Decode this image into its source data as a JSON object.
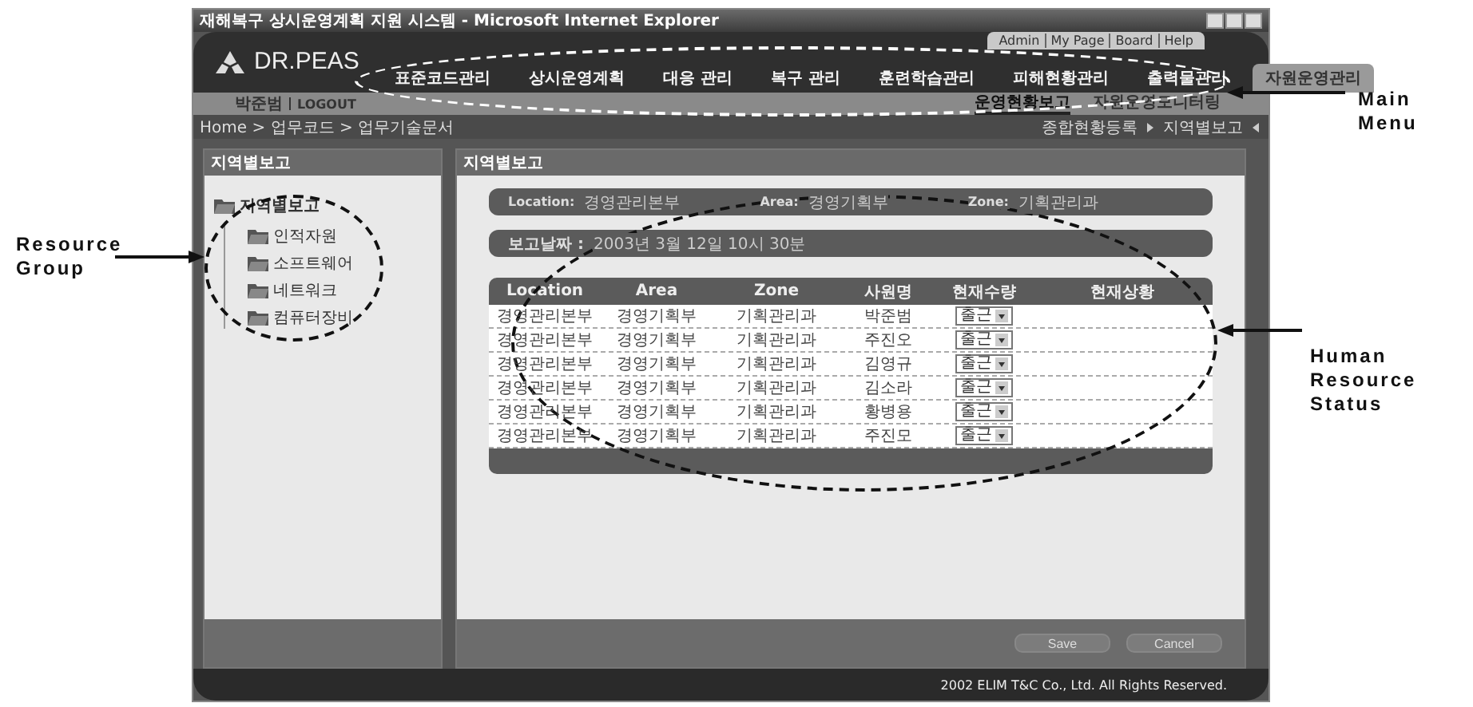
{
  "window": {
    "title": "재해복구 상시운영계획 지원 시스템 - Microsoft Internet Explorer"
  },
  "header": {
    "logo": "DR.PEAS",
    "top_links": [
      "Admin",
      "My Page",
      "Board",
      "Help"
    ],
    "user": "박준범",
    "logout": "LOGOUT"
  },
  "main_menu": [
    {
      "label": "표준코드관리",
      "selected": false
    },
    {
      "label": "상시운영계획",
      "selected": false
    },
    {
      "label": "대응 관리",
      "selected": false
    },
    {
      "label": "복구 관리",
      "selected": false
    },
    {
      "label": "훈련학습관리",
      "selected": false
    },
    {
      "label": "피해현황관리",
      "selected": false
    },
    {
      "label": "출력물관리",
      "selected": false
    },
    {
      "label": "자원운영관리",
      "selected": true
    }
  ],
  "sub_menu": [
    {
      "label": "운영현황보고",
      "selected": true
    },
    {
      "label": "자원운영모니터링",
      "selected": false
    }
  ],
  "breadcrumb": "Home > 업무코드 > 업무기술문서",
  "page_nav": [
    "종합현황등록",
    "지역별보고"
  ],
  "sidebar": {
    "title": "지역별보고",
    "tree": [
      {
        "label": "지역별보고",
        "children": [
          {
            "label": "인적자원"
          },
          {
            "label": "소프트웨어"
          },
          {
            "label": "네트워크"
          },
          {
            "label": "컴퓨터장비"
          }
        ]
      }
    ]
  },
  "main": {
    "title": "지역별보고",
    "filters": [
      {
        "label": "Location:",
        "value": "경영관리본부"
      },
      {
        "label": "Area:",
        "value": "경영기획부"
      },
      {
        "label": "Zone:",
        "value": "기획관리과"
      }
    ],
    "report_date": {
      "label": "보고날짜 :",
      "value": "2003년 3월 12일 10시 30분"
    },
    "table": {
      "columns": [
        "Location",
        "Area",
        "Zone",
        "사원명",
        "현재수량",
        "현재상황"
      ],
      "rows": [
        [
          "경영관리본부",
          "경영기획부",
          "기획관리과",
          "박준범",
          "출근"
        ],
        [
          "경영관리본부",
          "경영기획부",
          "기획관리과",
          "주진오",
          "출근"
        ],
        [
          "경영관리본부",
          "경영기획부",
          "기획관리과",
          "김영규",
          "출근"
        ],
        [
          "경영관리본부",
          "경영기획부",
          "기획관리과",
          "김소라",
          "출근"
        ],
        [
          "경영관리본부",
          "경영기획부",
          "기획관리과",
          "황병용",
          "출근"
        ],
        [
          "경영관리본부",
          "경영기획부",
          "기획관리과",
          "주진모",
          "출근"
        ]
      ]
    },
    "buttons": [
      "Save",
      "Cancel"
    ]
  },
  "footer": "2002 ELIM T&C Co., Ltd. All Rights Reserved.",
  "annotations": [
    "Main Menu",
    "Resource Group",
    "Human Resource Status"
  ]
}
